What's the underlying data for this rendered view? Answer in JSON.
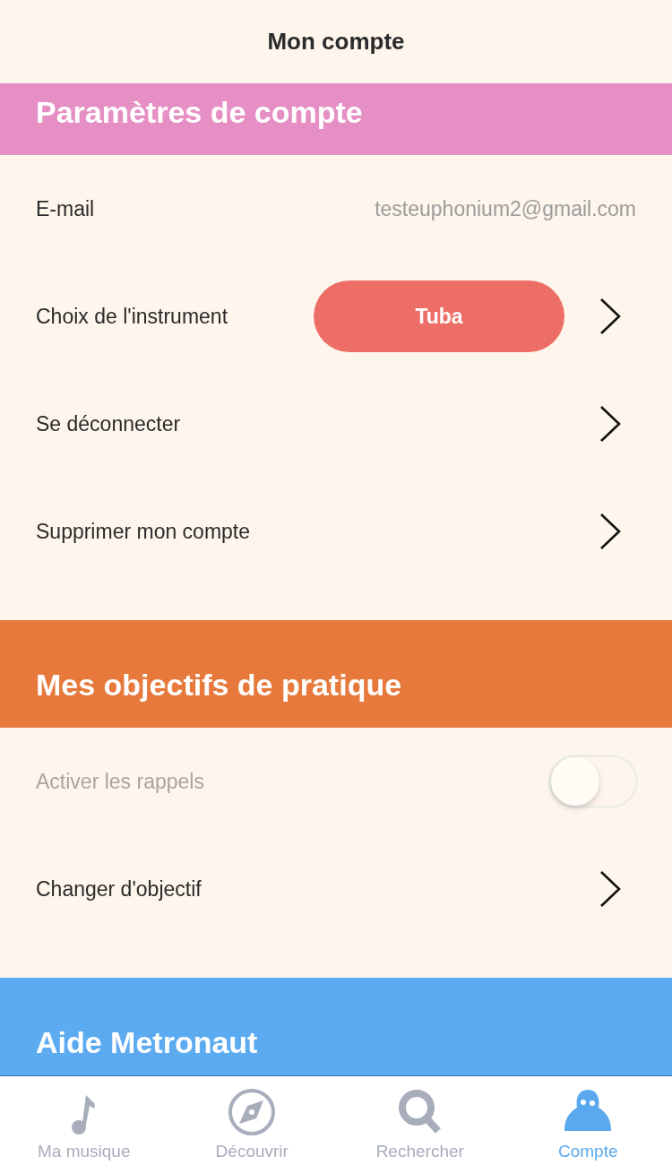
{
  "nav_bar": {
    "title": "Mon compte"
  },
  "sections": [
    {
      "title": "Paramètres de compte",
      "color": "#e68fc4",
      "rows": [
        {
          "kind": "value",
          "label": "E-mail",
          "value": "testeuphonium2@gmail.com",
          "disabled": false
        },
        {
          "kind": "button",
          "label": "Choix de l'instrument",
          "value": "Tuba",
          "disabled": false
        },
        {
          "kind": "link",
          "label": "Se déconnecter",
          "disabled": false
        },
        {
          "kind": "link",
          "label": "Supprimer mon compte",
          "disabled": false
        }
      ]
    },
    {
      "title": "Mes objectifs de pratique",
      "color": "#e6793b",
      "rows": [
        {
          "kind": "toggle",
          "label": "Activer les rappels",
          "on": false,
          "disabled": true
        },
        {
          "kind": "link",
          "label": "Changer d'objectif",
          "disabled": false
        }
      ]
    },
    {
      "title": "Aide Metronaut",
      "color": "#5cabf0"
    }
  ],
  "tab_bar": [
    {
      "label": "Ma musique",
      "selected": false
    },
    {
      "label": "Découvrir",
      "selected": false
    },
    {
      "label": "Rechercher",
      "selected": false
    },
    {
      "label": "Compte",
      "selected": true
    }
  ]
}
